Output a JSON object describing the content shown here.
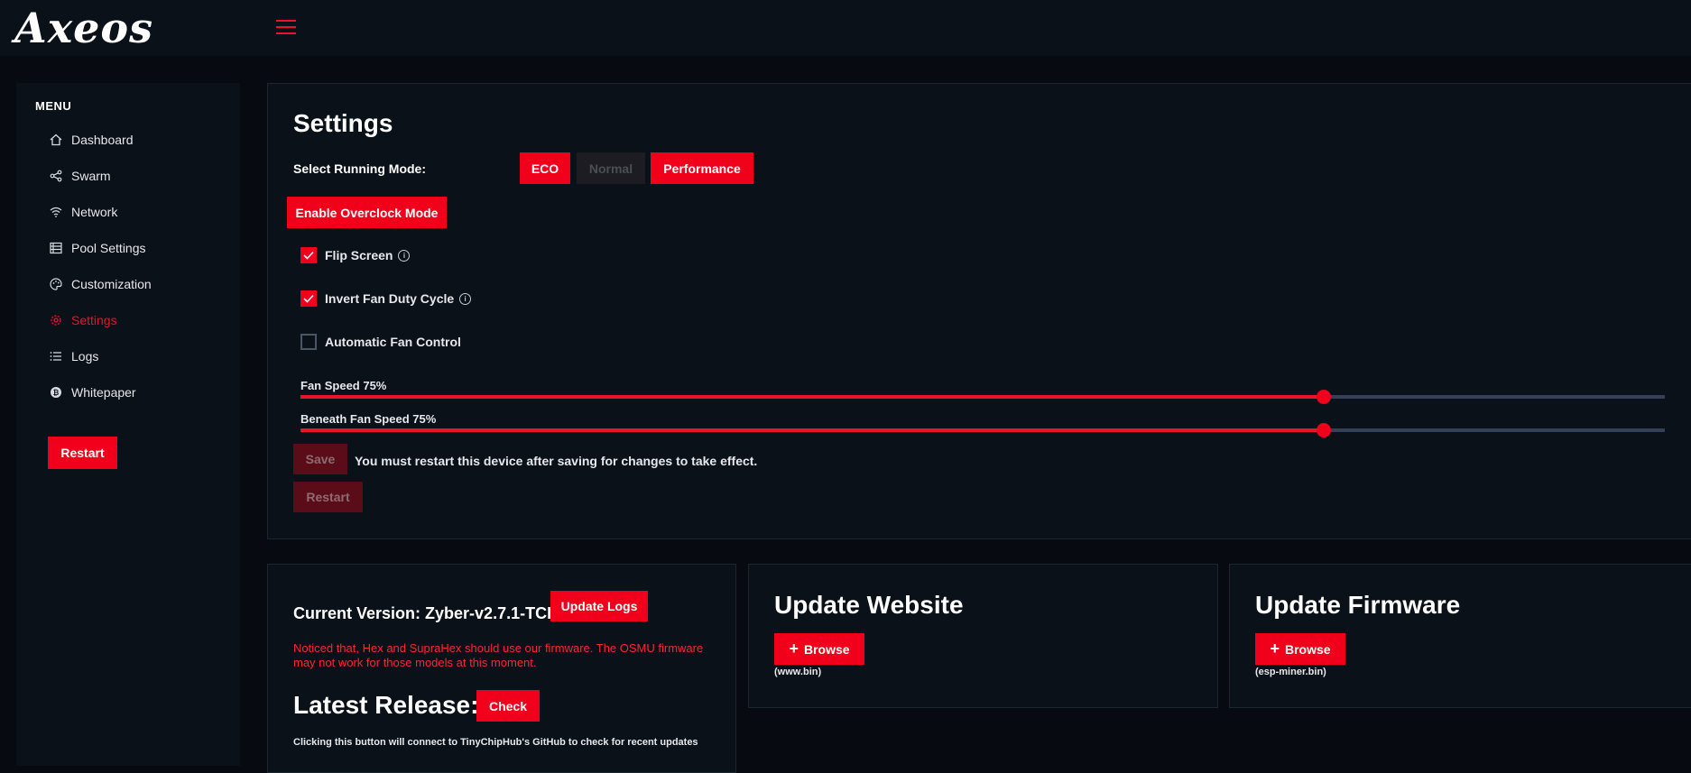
{
  "app": {
    "logo": "Axeos"
  },
  "sidebar": {
    "menu_title": "MENU",
    "items": [
      {
        "label": "Dashboard",
        "icon": "home-icon"
      },
      {
        "label": "Swarm",
        "icon": "share-icon"
      },
      {
        "label": "Network",
        "icon": "wifi-icon"
      },
      {
        "label": "Pool Settings",
        "icon": "server-icon"
      },
      {
        "label": "Customization",
        "icon": "palette-icon"
      },
      {
        "label": "Settings",
        "icon": "gear-icon",
        "active": true
      },
      {
        "label": "Logs",
        "icon": "list-icon"
      },
      {
        "label": "Whitepaper",
        "icon": "bitcoin-icon"
      }
    ],
    "restart_label": "Restart"
  },
  "settings": {
    "title": "Settings",
    "mode_label": "Select Running Mode:",
    "modes": {
      "eco": "ECO",
      "normal": "Normal",
      "performance": "Performance"
    },
    "overclock_label": "Enable Overclock Mode",
    "flip_screen": {
      "label": "Flip Screen",
      "checked": true
    },
    "invert_fan": {
      "label": "Invert Fan Duty Cycle",
      "checked": true
    },
    "auto_fan": {
      "label": "Automatic Fan Control",
      "checked": false
    },
    "fan_speed": {
      "label": "Fan Speed 75%",
      "value": 75
    },
    "beneath_fan_speed": {
      "label": "Beneath Fan Speed 75%",
      "value": 75
    },
    "save_label": "Save",
    "save_note": "You must restart this device after saving for changes to take effect.",
    "restart_label": "Restart"
  },
  "version": {
    "current": "Current Version: Zyber-v2.7.1-TCH",
    "update_logs_label": "Update Logs",
    "warning": "Noticed that, Hex and SupraHex should use our firmware. The OSMU firmware may not work for those models at this moment.",
    "latest_title": "Latest Release:",
    "check_label": "Check",
    "check_note": "Clicking this button will connect to TinyChipHub's GitHub to check for recent updates"
  },
  "update_website": {
    "title": "Update Website",
    "browse_label": "Browse",
    "file_hint": "(www.bin)"
  },
  "update_firmware": {
    "title": "Update Firmware",
    "browse_label": "Browse",
    "file_hint": "(esp-miner.bin)"
  },
  "colors": {
    "accent": "#f0001b",
    "background": "#070b11",
    "panel": "#0b1118"
  }
}
